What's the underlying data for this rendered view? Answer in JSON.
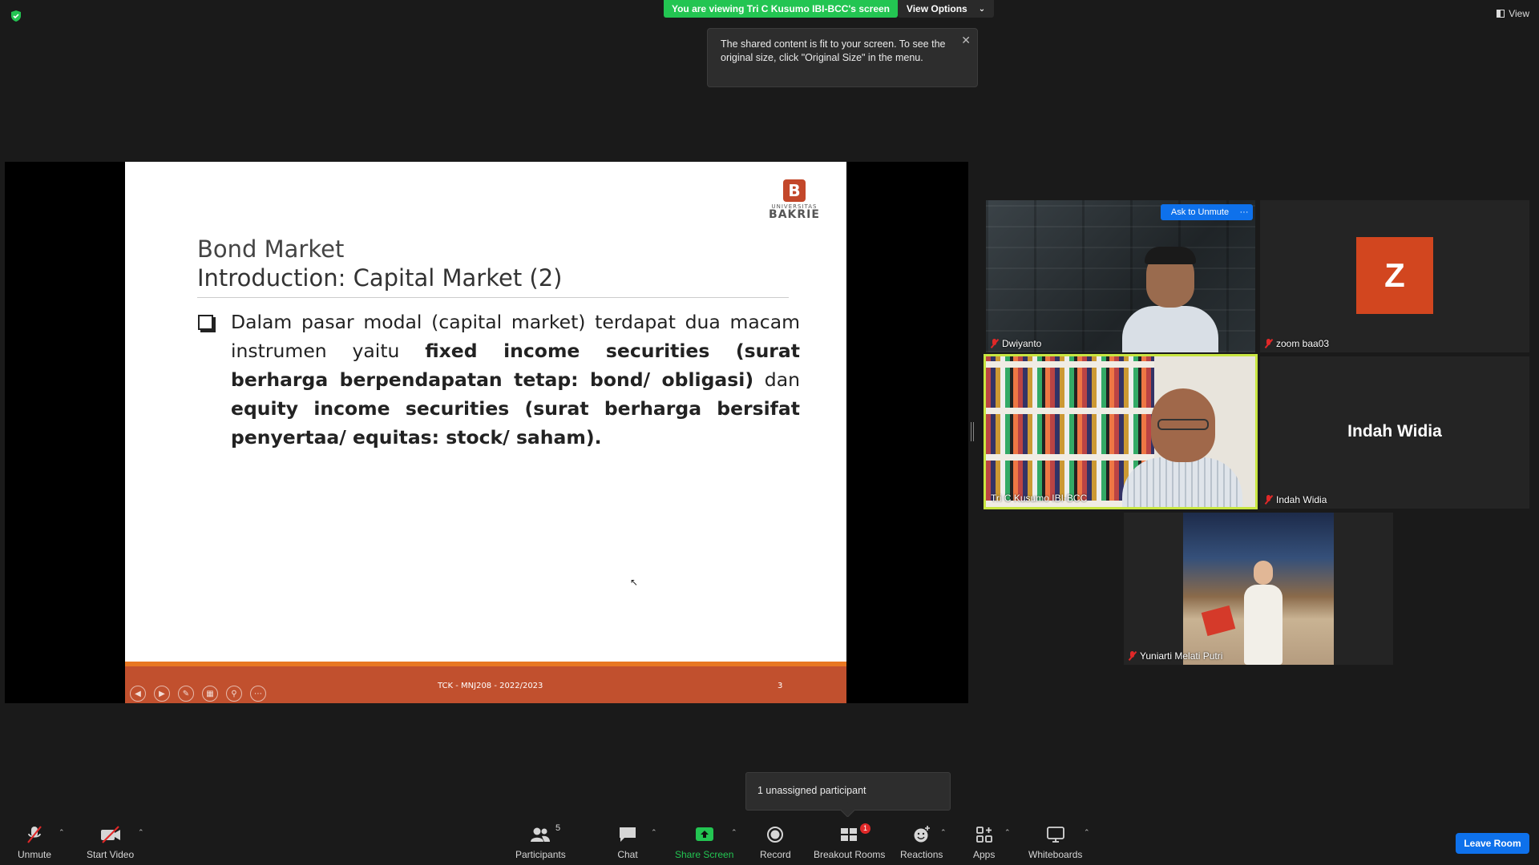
{
  "top": {
    "viewing_banner": "You are viewing Tri C Kusumo IBI-BCC's screen",
    "view_options": "View Options",
    "tooltip_text": "The shared content is fit to your screen. To see the original size, click \"Original Size\" in the menu.",
    "view_button": "View"
  },
  "slide": {
    "logo_small": "UNIVERSITAS",
    "logo_big": "BAKRIE",
    "subtitle": "Bond Market",
    "title": "Introduction: Capital Market (2)",
    "body_parts": [
      "Dalam pasar modal (capital market)  terdapat dua macam instrumen yaitu ",
      "fixed income securities (surat berharga berpendapatan tetap: bond/ obligasi)",
      " dan ",
      "equity income securities (surat berharga bersifat penyertaa/ equitas: stock/ saham)."
    ],
    "footer_text": "TCK - MNJ208 - 2022/2023",
    "page_number": "3"
  },
  "participants": [
    {
      "name": "Dwiyanto",
      "muted": true
    },
    {
      "name": "zoom baa03",
      "muted": true,
      "avatar_letter": "Z",
      "avatar_color": "#d2461f"
    },
    {
      "name": "Tri C Kusumo IBI-BCC",
      "muted": false,
      "active_speaker": true
    },
    {
      "name": "Indah Widia",
      "muted": true,
      "display_name_center": "Indah Widia"
    },
    {
      "name": "Yuniarti Melati Putri",
      "muted": true
    }
  ],
  "tile_actions": {
    "ask_to_unmute": "Ask to Unmute",
    "more": "···"
  },
  "popup": {
    "unassigned": "1 unassigned participant"
  },
  "toolbar": {
    "unmute": "Unmute",
    "start_video": "Start Video",
    "participants": "Participants",
    "participants_count": "5",
    "chat": "Chat",
    "share_screen": "Share Screen",
    "record": "Record",
    "breakout_rooms": "Breakout Rooms",
    "breakout_badge": "1",
    "reactions": "Reactions",
    "apps": "Apps",
    "whiteboards": "Whiteboards",
    "leave_room": "Leave Room"
  },
  "colors": {
    "share_green": "#23c552",
    "zoom_blue": "#0e71eb",
    "speaker_highlight": "#c8e641",
    "slide_footer": "#c1502e"
  }
}
